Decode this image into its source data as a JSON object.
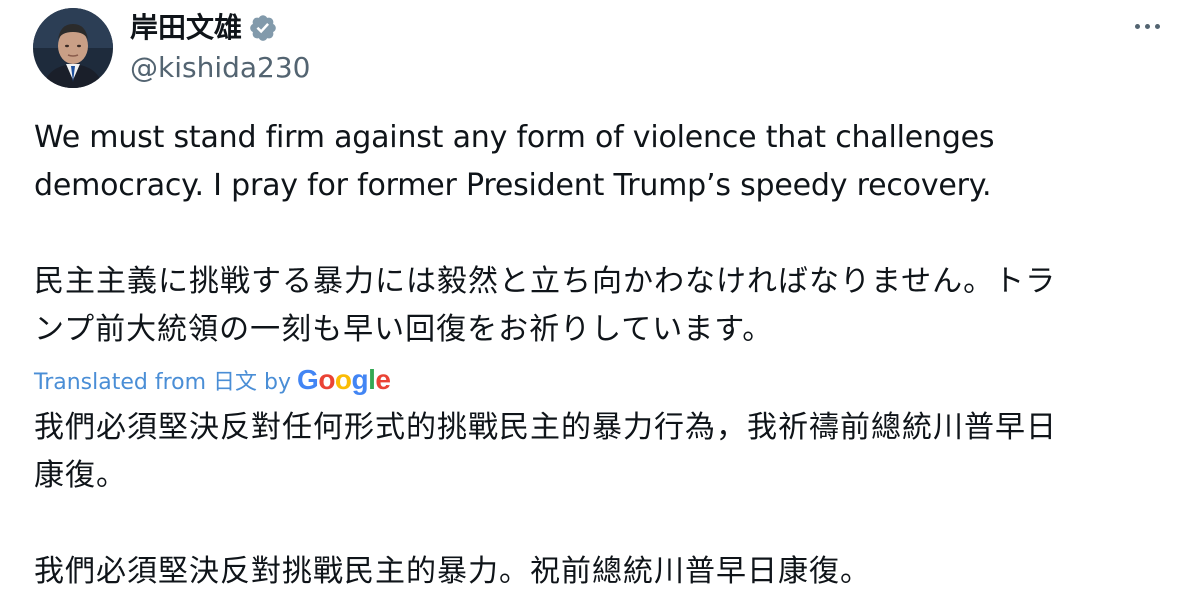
{
  "author": {
    "display_name": "岸田文雄",
    "handle": "@kishida230",
    "verified": true,
    "verified_color": "#829aab"
  },
  "menu": {
    "icon": "more-icon"
  },
  "tweet": {
    "english_line1": "We must stand firm against any form of violence that challenges",
    "english_line2": "democracy. I pray for former President Trump’s speedy recovery.",
    "japanese_line1": "民主主義に挑戦する暴力には毅然と立ち向かわなければなりません。トラ",
    "japanese_line2": "ンプ前大統領の一刻も早い回復をお祈りしています。"
  },
  "translation": {
    "label": "Translated from 日文 by",
    "provider": "Google",
    "text_line1": "我們必須堅決反對任何形式的挑戰民主的暴力行為，我祈禱前總統川普早日",
    "text_line2": "康復。",
    "text_line3": "我們必須堅決反對挑戰民主的暴力。祝前總統川普早日康復。",
    "link_color": "#4a8ed6"
  }
}
